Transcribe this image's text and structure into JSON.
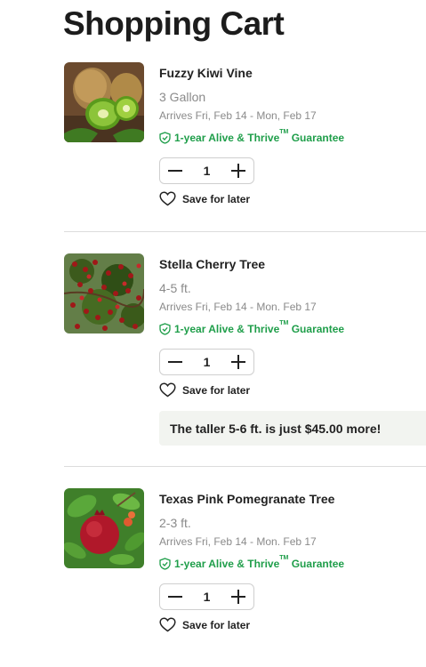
{
  "page": {
    "title": "Shopping Cart"
  },
  "items": [
    {
      "name": "Fuzzy Kiwi Vine",
      "size": "3 Gallon",
      "arrives": "Arrives Fri, Feb 14 - Mon, Feb 17",
      "guarantee": "1-year Alive & Thrive",
      "guarantee_tm": "TM",
      "guarantee_suffix": " Guarantee",
      "quantity": "1",
      "save_label": "Save for later"
    },
    {
      "name": "Stella Cherry Tree",
      "size": "4-5 ft.",
      "arrives": "Arrives Fri, Feb 14 - Mon. Feb 17",
      "guarantee": "1-year Alive & Thrive",
      "guarantee_tm": "TM",
      "guarantee_suffix": " Guarantee",
      "quantity": "1",
      "save_label": "Save for later",
      "upsell": "The taller 5-6 ft. is just $45.00 more!"
    },
    {
      "name": "Texas Pink Pomegranate Tree",
      "size": "2-3 ft.",
      "arrives": "Arrives Fri, Feb 14 - Mon. Feb 17",
      "guarantee": "1-year Alive & Thrive",
      "guarantee_tm": "TM",
      "guarantee_suffix": " Guarantee",
      "quantity": "1",
      "save_label": "Save for later"
    }
  ],
  "icons": {
    "shield": "shield-check-icon",
    "heart": "heart-icon",
    "minus": "minus-icon",
    "plus": "plus-icon"
  },
  "colors": {
    "guarantee_green": "#1f9e4a",
    "upsell_bg": "#f2f4f0",
    "muted_text": "#8a8a8a"
  }
}
